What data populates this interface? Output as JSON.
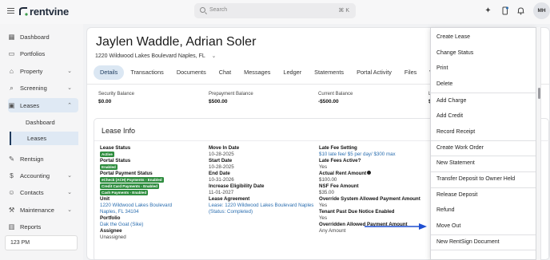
{
  "topbar": {
    "brand": "rentvine",
    "search_placeholder": "Search",
    "search_shortcut": "⌘ K",
    "avatar_initials": "MH"
  },
  "sidebar": {
    "items": [
      {
        "label": "Dashboard",
        "icon": "dashboard-icon"
      },
      {
        "label": "Portfolios",
        "icon": "folder-icon"
      },
      {
        "label": "Property",
        "icon": "house-icon"
      },
      {
        "label": "Screening",
        "icon": "screening-icon"
      },
      {
        "label": "Leases",
        "icon": "lease-icon"
      },
      {
        "label": "Rentsign",
        "icon": "sign-icon"
      },
      {
        "label": "Accounting",
        "icon": "dollar-icon"
      },
      {
        "label": "Contacts",
        "icon": "contacts-icon"
      },
      {
        "label": "Maintenance",
        "icon": "wrench-icon"
      },
      {
        "label": "Reports",
        "icon": "chart-icon"
      }
    ],
    "lease_subitems": [
      "Dashboard",
      "Leases"
    ],
    "clock": "123 PM"
  },
  "page": {
    "title": "Jaylen Waddle, Adrian Soler",
    "address": "1220 Wildwood Lakes Boulevard Naples, FL",
    "tabs": [
      "Details",
      "Transactions",
      "Documents",
      "Chat",
      "Messages",
      "Ledger",
      "Statements",
      "Portal Activity",
      "Files",
      "Work Or"
    ],
    "active_tab": "Details",
    "stats": [
      {
        "label": "Security Balance",
        "value": "$0.00"
      },
      {
        "label": "Prepayment Balance",
        "value": "$500.00"
      },
      {
        "label": "Current Balance",
        "value": "-$500.00"
      },
      {
        "label": "L",
        "value": "$"
      }
    ]
  },
  "lease_info": {
    "title": "Lease Info",
    "col1": {
      "lease_status_label": "Lease Status",
      "lease_status_badge": "Active",
      "portal_status_label": "Portal Status",
      "portal_status_badge": "Enabled",
      "portal_payment_label": "Portal Payment Status",
      "payment_badges": [
        "eCheck (ACH) Payments - Enabled",
        "Credit Card Payments - Enabled",
        "Cash Payments - Enabled"
      ],
      "unit_label": "Unit",
      "unit_line1": "1220 Wildwood Lakes Boulevard",
      "unit_line2": "Naples, FL 34104",
      "portfolio_label": "Portfolio",
      "portfolio_value": "Dak the Goat (Sike)",
      "assignee_label": "Assignee",
      "assignee_value": "Unassigned"
    },
    "col2": {
      "move_in_label": "Move In Date",
      "move_in_value": "10-28-2025",
      "start_label": "Start Date",
      "start_value": "10-28-2025",
      "end_label": "End Date",
      "end_value": "10-31-2026",
      "increase_label": "Increase Eligibility Date",
      "increase_value": "11-01-2027",
      "agreement_label": "Lease Agreement",
      "agreement_value": "Lease: 1220 Wildwood Lakes Boulevard Naples",
      "agreement_status": "(Status: Completed)"
    },
    "col3": {
      "late_fee_label": "Late Fee Setting",
      "late_fee_value": "$10 late fee/ $5 per day/ $300 max",
      "late_fees_active_label": "Late Fees Active?",
      "late_fees_active_value": "Yes",
      "actual_rent_label": "Actual Rent Amount",
      "actual_rent_value": "$100.00",
      "nsf_label": "NSF Fee Amount",
      "nsf_value": "$35.00",
      "override_label": "Override System Allowed Payment Amount",
      "override_value": "Yes",
      "tenant_notice_label": "Tenant Past Due Notice Enabled",
      "tenant_notice_value": "Yes",
      "overridden_label": "Overridden Allowed Payment Amount",
      "overridden_value": "Any Amount"
    }
  },
  "menu": {
    "items": [
      "Create Lease",
      "Change Status",
      "Print",
      "Delete",
      "Add Charge",
      "Add Credit",
      "Record Receipt",
      "Create Work Order",
      "New Statement",
      "Transfer Deposit to Owner Held",
      "Release Deposit",
      "Refund",
      "Move Out",
      "New RentSign Document"
    ]
  },
  "colors": {
    "accent": "#2c6fb0",
    "active_badge": "#2f8d3f",
    "arrow": "#1f4fd1",
    "nav_active_bg": "#dfe9f4"
  }
}
